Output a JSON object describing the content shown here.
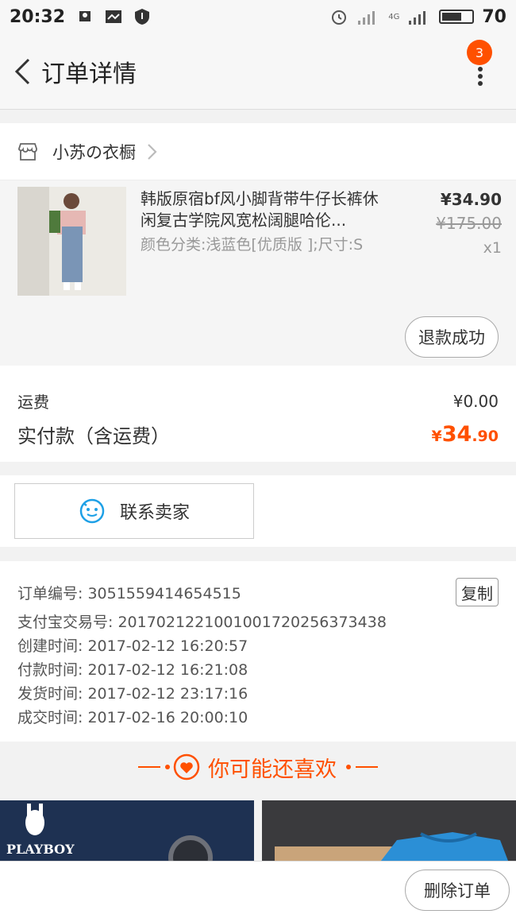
{
  "status_bar": {
    "time": "20:32",
    "battery_level": "70",
    "network_label": "4G"
  },
  "nav": {
    "title": "订单详情",
    "badge_count": "3"
  },
  "shop": {
    "name": "小苏の衣橱"
  },
  "product": {
    "name": "韩版原宿bf风小脚背带牛仔长裤休闲复古学院风宽松阔腿哈伦...",
    "spec": "颜色分类:浅蓝色[优质版 ];尺寸:S",
    "price": "¥34.90",
    "original_price": "¥175.00",
    "quantity": "x1",
    "status_button": "退款成功"
  },
  "fees": {
    "shipping_label": "运费",
    "shipping_value": "¥0.00",
    "paid_label": "实付款（含运费）",
    "paid_currency": "¥",
    "paid_integer": "34",
    "paid_decimal": ".90"
  },
  "contact": {
    "label": "联系卖家"
  },
  "order_info": {
    "order_no": "订单编号: 3051559414654515",
    "copy_label": "复制",
    "alipay_no": "支付宝交易号: 2017021221001001720256373438",
    "created": "创建时间: 2017-02-12 16:20:57",
    "paid": "付款时间: 2017-02-12 16:21:08",
    "shipped": "发货时间: 2017-02-12 23:17:16",
    "completed": "成交时间: 2017-02-16 20:00:10"
  },
  "recommend": {
    "title": "你可能还喜欢",
    "item1_brand": "PLAYBOY"
  },
  "bottom": {
    "delete_label": "删除订单"
  },
  "colors": {
    "accent": "#ff5000",
    "playboy_bg": "#1e3152"
  }
}
